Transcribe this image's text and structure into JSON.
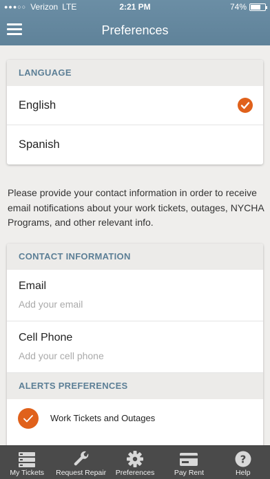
{
  "status": {
    "carrier": "Verizon",
    "network": "LTE",
    "time": "2:21 PM",
    "battery": "74%",
    "battery_level": 0.74
  },
  "header": {
    "title": "Preferences"
  },
  "language": {
    "heading": "LANGUAGE",
    "options": [
      {
        "label": "English",
        "selected": true
      },
      {
        "label": "Spanish",
        "selected": false
      }
    ]
  },
  "intro_text": "Please provide your contact information in order to receive email notifications about your work tickets, outages, NYCHA Programs, and other relevant info.",
  "contact": {
    "heading": "CONTACT INFORMATION",
    "email": {
      "label": "Email",
      "placeholder": "Add your email",
      "value": ""
    },
    "phone": {
      "label": "Cell Phone",
      "placeholder": "Add your cell phone",
      "value": ""
    }
  },
  "alerts": {
    "heading": "ALERTS PREFERENCES",
    "items": [
      {
        "label": "Work Tickets and Outages",
        "checked": true
      }
    ]
  },
  "tabbar": {
    "items": [
      {
        "label": "My Tickets",
        "icon": "tickets-icon"
      },
      {
        "label": "Request Repair",
        "icon": "wrench-icon"
      },
      {
        "label": "Preferences",
        "icon": "gear-icon"
      },
      {
        "label": "Pay Rent",
        "icon": "card-icon"
      },
      {
        "label": "Help",
        "icon": "help-icon"
      }
    ]
  },
  "colors": {
    "accent": "#e0611b",
    "header": "#6b8ea5",
    "section_text": "#5c7f96",
    "tabbar": "#4a4a4a"
  }
}
